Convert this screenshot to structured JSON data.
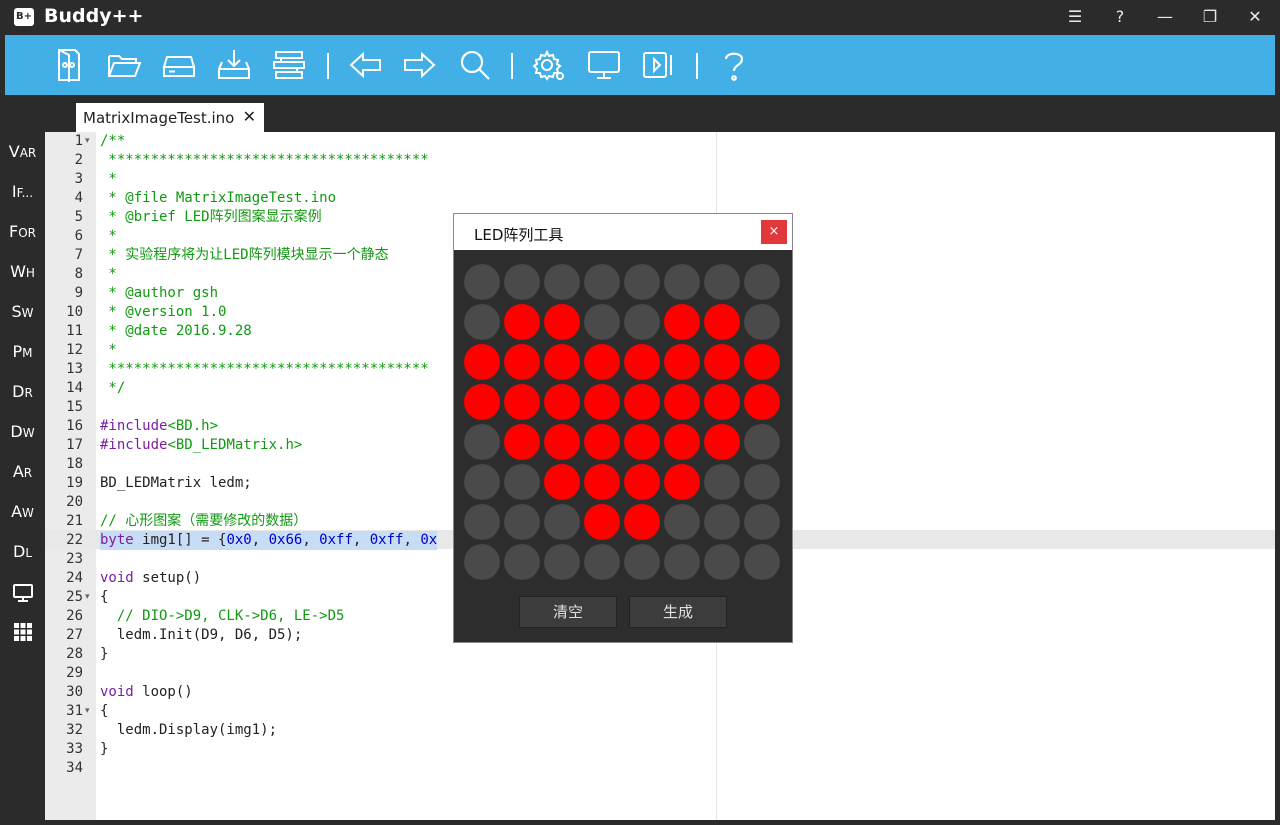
{
  "app": {
    "title": "Buddy++",
    "logo_text": "B+",
    "accent": "#42b0e6",
    "window_controls": [
      "menu-icon",
      "help-icon",
      "minimize-icon",
      "restore-icon",
      "close-icon"
    ]
  },
  "window": {
    "menu": "☰",
    "help": "?",
    "minimize": "—",
    "restore": "❐",
    "close": "✕"
  },
  "toolbar": {
    "icons": [
      "new-file-icon",
      "open-folder-icon",
      "drive-icon",
      "download-icon",
      "build-icon",
      "back-arrow-icon",
      "forward-arrow-icon",
      "search-icon",
      "settings-icon",
      "monitor-icon",
      "upload-icon",
      "help-icon"
    ]
  },
  "sidebar": {
    "items": [
      {
        "big": "V",
        "small": "AR"
      },
      {
        "big": "I",
        "small": "F..."
      },
      {
        "big": "F",
        "small": "OR"
      },
      {
        "big": "W",
        "small": "H"
      },
      {
        "big": "S",
        "small": "W"
      },
      {
        "big": "P",
        "small": "M"
      },
      {
        "big": "D",
        "small": "R"
      },
      {
        "big": "D",
        "small": "W"
      },
      {
        "big": "A",
        "small": "R"
      },
      {
        "big": "A",
        "small": "W"
      },
      {
        "big": "D",
        "small": "L"
      }
    ],
    "icons": [
      "serial-monitor-icon",
      "led-matrix-icon"
    ]
  },
  "tab": {
    "label": "MatrixImageTest.ino",
    "close": "✕"
  },
  "editor": {
    "active_line": 22,
    "lines": [
      {
        "n": "1",
        "fold": true,
        "parts": [
          {
            "t": "/**",
            "c": "comment"
          }
        ]
      },
      {
        "n": "2",
        "parts": [
          {
            "t": " **************************************",
            "c": "comment"
          }
        ]
      },
      {
        "n": "3",
        "parts": [
          {
            "t": " *",
            "c": "comment"
          }
        ]
      },
      {
        "n": "4",
        "parts": [
          {
            "t": " * @file MatrixImageTest.ino",
            "c": "comment"
          }
        ]
      },
      {
        "n": "5",
        "parts": [
          {
            "t": " * @brief LED阵列图案显示案例",
            "c": "comment"
          }
        ]
      },
      {
        "n": "6",
        "parts": [
          {
            "t": " *",
            "c": "comment"
          }
        ]
      },
      {
        "n": "7",
        "parts": [
          {
            "t": " * 实验程序将为让LED阵列模块显示一个静态",
            "c": "comment"
          }
        ]
      },
      {
        "n": "8",
        "parts": [
          {
            "t": " *",
            "c": "comment"
          }
        ]
      },
      {
        "n": "9",
        "parts": [
          {
            "t": " * @author gsh",
            "c": "comment"
          }
        ]
      },
      {
        "n": "10",
        "parts": [
          {
            "t": " * @version 1.0",
            "c": "comment"
          }
        ]
      },
      {
        "n": "11",
        "parts": [
          {
            "t": " * @date 2016.9.28",
            "c": "comment"
          }
        ]
      },
      {
        "n": "12",
        "parts": [
          {
            "t": " *",
            "c": "comment"
          }
        ]
      },
      {
        "n": "13",
        "parts": [
          {
            "t": " **************************************",
            "c": "comment"
          }
        ]
      },
      {
        "n": "14",
        "parts": [
          {
            "t": " */",
            "c": "comment"
          }
        ]
      },
      {
        "n": "15",
        "parts": []
      },
      {
        "n": "16",
        "parts": [
          {
            "t": "#include",
            "c": "keyword"
          },
          {
            "t": "<BD.h>",
            "c": "comment"
          }
        ]
      },
      {
        "n": "17",
        "parts": [
          {
            "t": "#include",
            "c": "keyword"
          },
          {
            "t": "<BD_LEDMatrix.h>",
            "c": "comment"
          }
        ]
      },
      {
        "n": "18",
        "parts": []
      },
      {
        "n": "19",
        "parts": [
          {
            "t": "BD_LEDMatrix ledm;",
            "c": "plain"
          }
        ]
      },
      {
        "n": "20",
        "parts": []
      },
      {
        "n": "21",
        "parts": [
          {
            "t": "// 心形图案（需要修改的数据）",
            "c": "comment"
          }
        ]
      },
      {
        "n": "22",
        "sel": true,
        "parts": [
          {
            "t": "byte",
            "c": "keyword"
          },
          {
            "t": " img1[] = {",
            "c": "plain"
          },
          {
            "t": "0x0",
            "c": "hex"
          },
          {
            "t": ", ",
            "c": "plain"
          },
          {
            "t": "0x66",
            "c": "hex"
          },
          {
            "t": ", ",
            "c": "plain"
          },
          {
            "t": "0xff",
            "c": "hex"
          },
          {
            "t": ", ",
            "c": "plain"
          },
          {
            "t": "0xff",
            "c": "hex"
          },
          {
            "t": ", ",
            "c": "plain"
          },
          {
            "t": "0x",
            "c": "hex"
          }
        ]
      },
      {
        "n": "23",
        "parts": []
      },
      {
        "n": "24",
        "parts": [
          {
            "t": "void",
            "c": "keyword"
          },
          {
            "t": " setup()",
            "c": "plain"
          }
        ]
      },
      {
        "n": "25",
        "fold": true,
        "parts": [
          {
            "t": "{",
            "c": "plain"
          }
        ]
      },
      {
        "n": "26",
        "parts": [
          {
            "t": "  // DIO->D9, CLK->D6, LE->D5",
            "c": "comment"
          }
        ]
      },
      {
        "n": "27",
        "parts": [
          {
            "t": "  ledm.Init(D9, D6, D5);",
            "c": "plain"
          }
        ]
      },
      {
        "n": "28",
        "parts": [
          {
            "t": "}",
            "c": "plain"
          }
        ]
      },
      {
        "n": "29",
        "parts": []
      },
      {
        "n": "30",
        "parts": [
          {
            "t": "void",
            "c": "keyword"
          },
          {
            "t": " loop()",
            "c": "plain"
          }
        ]
      },
      {
        "n": "31",
        "fold": true,
        "parts": [
          {
            "t": "{",
            "c": "plain"
          }
        ]
      },
      {
        "n": "32",
        "parts": [
          {
            "t": "  ledm.Display(img1);",
            "c": "plain"
          }
        ]
      },
      {
        "n": "33",
        "parts": [
          {
            "t": "}",
            "c": "plain"
          }
        ]
      },
      {
        "n": "34",
        "parts": []
      }
    ]
  },
  "led_dialog": {
    "title": "LED阵列工具",
    "close": "×",
    "on_color": "#ff0000",
    "off_color": "#4a4a4a",
    "grid": [
      [
        0,
        0,
        0,
        0,
        0,
        0,
        0,
        0
      ],
      [
        0,
        1,
        1,
        0,
        0,
        1,
        1,
        0
      ],
      [
        1,
        1,
        1,
        1,
        1,
        1,
        1,
        1
      ],
      [
        1,
        1,
        1,
        1,
        1,
        1,
        1,
        1
      ],
      [
        0,
        1,
        1,
        1,
        1,
        1,
        1,
        0
      ],
      [
        0,
        0,
        1,
        1,
        1,
        1,
        0,
        0
      ],
      [
        0,
        0,
        0,
        1,
        1,
        0,
        0,
        0
      ],
      [
        0,
        0,
        0,
        0,
        0,
        0,
        0,
        0
      ]
    ],
    "clear_label": "清空",
    "generate_label": "生成"
  }
}
